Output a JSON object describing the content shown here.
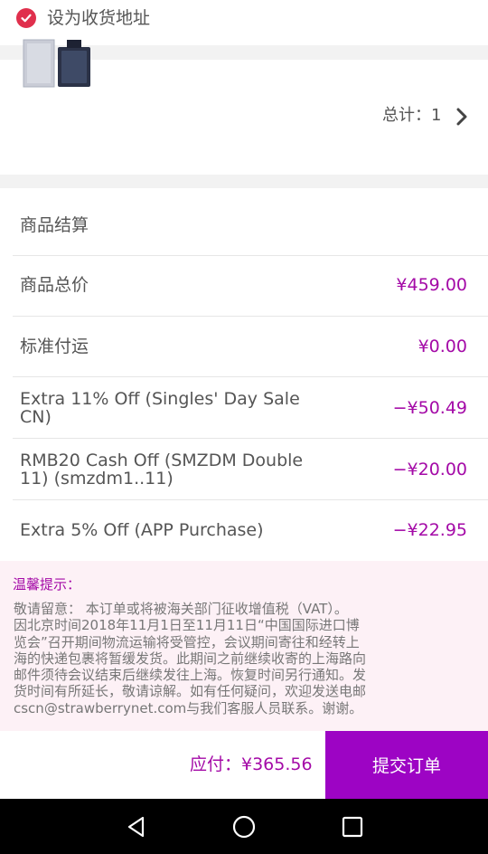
{
  "address": {
    "set_default_label": "设为收货地址",
    "checked": true
  },
  "product": {
    "thumbnail_icon": "perfume-bottle-icon",
    "total_label": "总计：1",
    "chevron_icon": "chevron-right-icon"
  },
  "settlement": {
    "title": "商品结算",
    "rows": [
      {
        "label": "商品总价",
        "value": "¥459.00"
      },
      {
        "label": "标准付运",
        "value": "¥0.00"
      },
      {
        "label": "Extra 11% Off (Singles' Day Sale\nCN)",
        "value": "−¥50.49"
      },
      {
        "label": "RMB20 Cash Off (SMZDM Double\n11) (smzdm1..11)",
        "value": "−¥20.00"
      },
      {
        "label": "Extra 5% Off (APP Purchase)",
        "value": "−¥22.95"
      }
    ]
  },
  "notice": {
    "title": "温馨提示：",
    "text": "敬请留意：  本订单或将被海关部门征收增值税（VAT）。\n因北京时间2018年11月1日至11月11日“中国国际进口博\n览会”召开期间物流运输将受管控，会议期间寄往和经转上\n海的快递包裹将暂缓发货。此期间之前继续收寄的上海路向\n邮件须待会议结束后继续发往上海。恢复时间另行通知。发\n货时间有所延长，敬请谅解。如有任何疑问，欢迎发送电邮\ncscn@strawberrynet.com与我们客服人员联系。谢谢。"
  },
  "footer": {
    "pay_label": "应付：¥365.56",
    "submit_label": "提交订单"
  },
  "navbar": {
    "back_icon": "back-triangle-icon",
    "home_icon": "home-circle-icon",
    "recents_icon": "recents-square-icon"
  },
  "colors": {
    "accent": "#a40aa7",
    "submit_bg": "#9d04c4",
    "check": "#e0304d",
    "notice_bg": "#fdf1f6"
  }
}
